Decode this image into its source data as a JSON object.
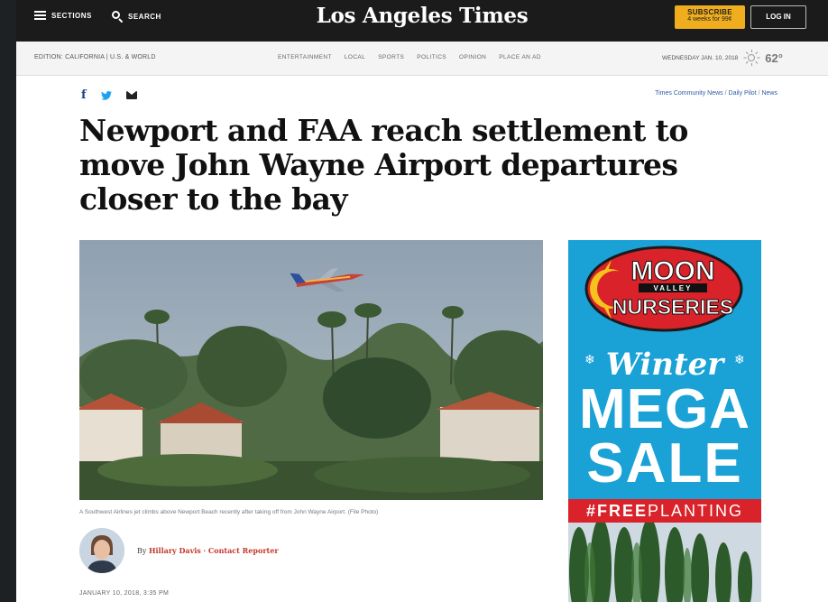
{
  "topbar": {
    "sections_label": "SECTIONS",
    "search_label": "SEARCH",
    "masthead": "Los Angeles Times",
    "subscribe_label": "SUBSCRIBE",
    "subscribe_offer": "4 weeks for 99¢",
    "login_label": "LOG IN"
  },
  "navbar": {
    "edition": "EDITION: CALIFORNIA | U.S. & WORLD",
    "links": [
      "ENTERTAINMENT",
      "LOCAL",
      "SPORTS",
      "POLITICS",
      "OPINION",
      "PLACE AN AD"
    ],
    "date": "WEDNESDAY JAN. 10, 2018",
    "temperature": "62°",
    "weather_icon": "sun-icon"
  },
  "article": {
    "social": [
      "facebook-icon",
      "twitter-icon",
      "email-icon"
    ],
    "breadcrumb": [
      "Times Community News",
      "Daily Pilot",
      "News"
    ],
    "headline": "Newport and FAA reach settlement to move John Wayne Airport departures closer to the bay",
    "photo_caption": "A Southwest Airlines jet climbs above Newport Beach recently after taking off from John Wayne Airport. (File Photo)",
    "byline_prefix": "By",
    "author": "Hillary Davis",
    "author_role": "Contact Reporter",
    "pubdate": "JANUARY 10, 2018, 3:35 PM"
  },
  "ad": {
    "brand_line1": "MOON",
    "brand_line2": "VALLEY",
    "brand_line3": "NURSERIES",
    "headline1": "Winter",
    "headline2": "MEGA",
    "headline3": "SALE",
    "hashtag_bold": "#FREE",
    "hashtag_rest": "PLANTING"
  },
  "colors": {
    "topbar": "#1b1b1b",
    "subscribe": "#f0ad1d",
    "ad_blue": "#1aa1d6",
    "ad_red": "#d9222a",
    "byline_red": "#c0392b",
    "link_blue": "#2a5ca8"
  }
}
